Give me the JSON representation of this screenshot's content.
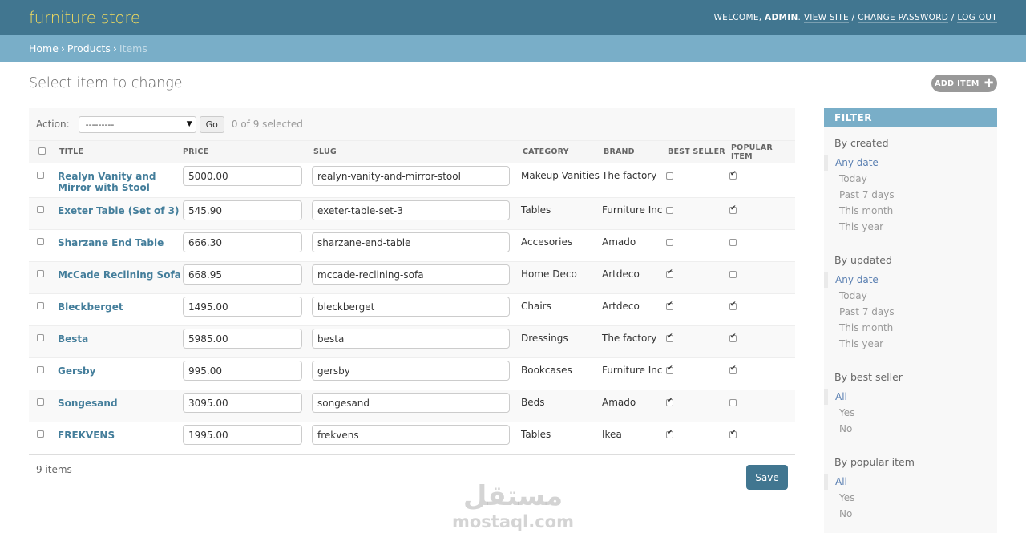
{
  "header": {
    "brand": "furniture store",
    "welcome": "Welcome,",
    "username": "admin",
    "view_site": "View site",
    "change_password": "Change password",
    "log_out": "Log out",
    "separator": "/"
  },
  "breadcrumbs": {
    "home": "Home",
    "products": "Products",
    "items": "Items",
    "sep": "›"
  },
  "page": {
    "title": "Select item to change",
    "add_button": "Add item"
  },
  "actions": {
    "label": "Action:",
    "select_value": "---------",
    "go": "Go",
    "counter": "0 of 9 selected"
  },
  "table": {
    "columns": [
      "Title",
      "Price",
      "Slug",
      "Category",
      "Brand",
      "Best seller",
      "Popular item"
    ],
    "rows": [
      {
        "title": "Realyn Vanity and Mirror with Stool",
        "price": "5000.00",
        "slug": "realyn-vanity-and-mirror-stool",
        "category": "Makeup Vanities",
        "brand": "The factory",
        "best_seller": false,
        "popular": true
      },
      {
        "title": "Exeter Table (Set of 3)",
        "price": "545.90",
        "slug": "exeter-table-set-3",
        "category": "Tables",
        "brand": "Furniture Inc",
        "best_seller": false,
        "popular": true
      },
      {
        "title": "Sharzane End Table",
        "price": "666.30",
        "slug": "sharzane-end-table",
        "category": "Accesories",
        "brand": "Amado",
        "best_seller": false,
        "popular": false
      },
      {
        "title": "McCade Reclining Sofa",
        "price": "668.95",
        "slug": "mccade-reclining-sofa",
        "category": "Home Deco",
        "brand": "Artdeco",
        "best_seller": true,
        "popular": false
      },
      {
        "title": "Bleckberget",
        "price": "1495.00",
        "slug": "bleckberget",
        "category": "Chairs",
        "brand": "Artdeco",
        "best_seller": true,
        "popular": true
      },
      {
        "title": "Besta",
        "price": "5985.00",
        "slug": "besta",
        "category": "Dressings",
        "brand": "The factory",
        "best_seller": true,
        "popular": true
      },
      {
        "title": "Gersby",
        "price": "995.00",
        "slug": "gersby",
        "category": "Bookcases",
        "brand": "Furniture Inc",
        "best_seller": true,
        "popular": true
      },
      {
        "title": "Songesand",
        "price": "3095.00",
        "slug": "songesand",
        "category": "Beds",
        "brand": "Amado",
        "best_seller": true,
        "popular": false
      },
      {
        "title": "FREKVENS",
        "price": "1995.00",
        "slug": "frekvens",
        "category": "Tables",
        "brand": "Ikea",
        "best_seller": true,
        "popular": true
      }
    ]
  },
  "paginator": {
    "count": "9 items",
    "save": "Save"
  },
  "filter": {
    "title": "Filter",
    "groups": [
      {
        "title": "By created",
        "options": [
          "Any date",
          "Today",
          "Past 7 days",
          "This month",
          "This year"
        ],
        "selected": 0
      },
      {
        "title": "By updated",
        "options": [
          "Any date",
          "Today",
          "Past 7 days",
          "This month",
          "This year"
        ],
        "selected": 0
      },
      {
        "title": "By best seller",
        "options": [
          "All",
          "Yes",
          "No"
        ],
        "selected": 0
      },
      {
        "title": "By popular item",
        "options": [
          "All",
          "Yes",
          "No"
        ],
        "selected": 0
      }
    ]
  },
  "watermark": {
    "arabic": "مستقل",
    "latin": "mostaql.com"
  }
}
